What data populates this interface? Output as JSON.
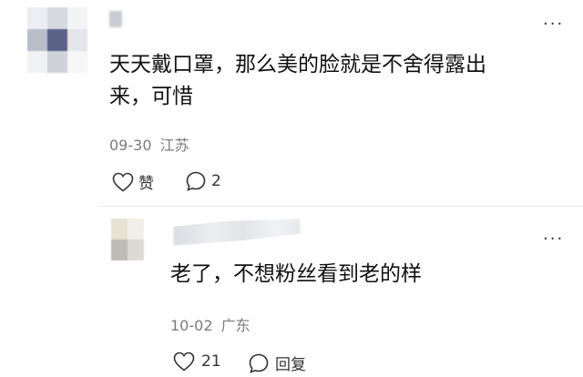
{
  "comment": {
    "text_line1": "天天戴口罩，那么美的脸就是不舍得露出",
    "text_line2": "来，可惜",
    "date": "09-30",
    "location": "江苏",
    "like_label": "赞",
    "reply_count": "2",
    "more_icon": "ellipsis-icon"
  },
  "reply": {
    "text": "老了，不想粉丝看到老的样",
    "date": "10-02",
    "location": "广东",
    "like_count": "21",
    "reply_label": "回复",
    "more_icon": "ellipsis-icon"
  },
  "more_glyph": "···",
  "colors": {
    "text": "#111111",
    "meta": "#7a7a7a",
    "icon": "#333333"
  }
}
